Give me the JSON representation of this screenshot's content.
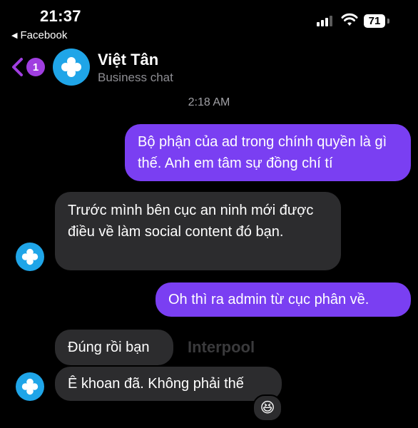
{
  "status_bar": {
    "time": "21:37",
    "back_app": "Facebook",
    "battery": "71"
  },
  "header": {
    "unread_count": "1",
    "contact_name": "Việt Tân",
    "subtitle": "Business chat"
  },
  "conversation": {
    "timestamp": "2:18 AM",
    "messages": [
      {
        "direction": "outgoing",
        "text": "Bộ phận của ad trong chính quyền là gì thế. Anh em tâm sự đồng chí tí"
      },
      {
        "direction": "incoming",
        "text": "Trước mình bên cục an ninh mới được điều về làm social content đó bạn."
      },
      {
        "direction": "outgoing",
        "text": "Oh thì ra admin từ cục phân về."
      },
      {
        "direction": "incoming",
        "text": "Đúng rồi bạn"
      },
      {
        "direction": "incoming",
        "text": "Ê khoan đã. Không phải thế"
      }
    ],
    "watermark": "Interpool",
    "reaction": "😆"
  },
  "colors": {
    "outgoing_bubble": "#7a3ff2",
    "incoming_bubble": "#2c2c2e",
    "accent": "#a03ee0",
    "avatar": "#1fa5e8"
  }
}
